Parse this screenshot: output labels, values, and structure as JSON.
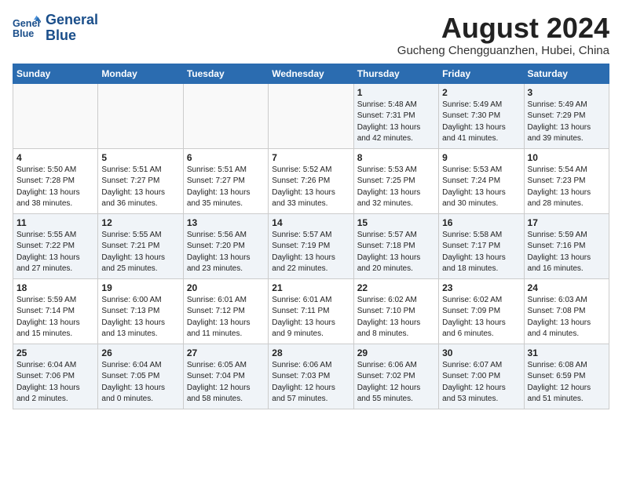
{
  "logo": {
    "line1": "General",
    "line2": "Blue"
  },
  "title": "August 2024",
  "location": "Gucheng Chengguanzhen, Hubei, China",
  "days_of_week": [
    "Sunday",
    "Monday",
    "Tuesday",
    "Wednesday",
    "Thursday",
    "Friday",
    "Saturday"
  ],
  "weeks": [
    [
      {
        "day": "",
        "info": ""
      },
      {
        "day": "",
        "info": ""
      },
      {
        "day": "",
        "info": ""
      },
      {
        "day": "",
        "info": ""
      },
      {
        "day": "1",
        "info": "Sunrise: 5:48 AM\nSunset: 7:31 PM\nDaylight: 13 hours\nand 42 minutes."
      },
      {
        "day": "2",
        "info": "Sunrise: 5:49 AM\nSunset: 7:30 PM\nDaylight: 13 hours\nand 41 minutes."
      },
      {
        "day": "3",
        "info": "Sunrise: 5:49 AM\nSunset: 7:29 PM\nDaylight: 13 hours\nand 39 minutes."
      }
    ],
    [
      {
        "day": "4",
        "info": "Sunrise: 5:50 AM\nSunset: 7:28 PM\nDaylight: 13 hours\nand 38 minutes."
      },
      {
        "day": "5",
        "info": "Sunrise: 5:51 AM\nSunset: 7:27 PM\nDaylight: 13 hours\nand 36 minutes."
      },
      {
        "day": "6",
        "info": "Sunrise: 5:51 AM\nSunset: 7:27 PM\nDaylight: 13 hours\nand 35 minutes."
      },
      {
        "day": "7",
        "info": "Sunrise: 5:52 AM\nSunset: 7:26 PM\nDaylight: 13 hours\nand 33 minutes."
      },
      {
        "day": "8",
        "info": "Sunrise: 5:53 AM\nSunset: 7:25 PM\nDaylight: 13 hours\nand 32 minutes."
      },
      {
        "day": "9",
        "info": "Sunrise: 5:53 AM\nSunset: 7:24 PM\nDaylight: 13 hours\nand 30 minutes."
      },
      {
        "day": "10",
        "info": "Sunrise: 5:54 AM\nSunset: 7:23 PM\nDaylight: 13 hours\nand 28 minutes."
      }
    ],
    [
      {
        "day": "11",
        "info": "Sunrise: 5:55 AM\nSunset: 7:22 PM\nDaylight: 13 hours\nand 27 minutes."
      },
      {
        "day": "12",
        "info": "Sunrise: 5:55 AM\nSunset: 7:21 PM\nDaylight: 13 hours\nand 25 minutes."
      },
      {
        "day": "13",
        "info": "Sunrise: 5:56 AM\nSunset: 7:20 PM\nDaylight: 13 hours\nand 23 minutes."
      },
      {
        "day": "14",
        "info": "Sunrise: 5:57 AM\nSunset: 7:19 PM\nDaylight: 13 hours\nand 22 minutes."
      },
      {
        "day": "15",
        "info": "Sunrise: 5:57 AM\nSunset: 7:18 PM\nDaylight: 13 hours\nand 20 minutes."
      },
      {
        "day": "16",
        "info": "Sunrise: 5:58 AM\nSunset: 7:17 PM\nDaylight: 13 hours\nand 18 minutes."
      },
      {
        "day": "17",
        "info": "Sunrise: 5:59 AM\nSunset: 7:16 PM\nDaylight: 13 hours\nand 16 minutes."
      }
    ],
    [
      {
        "day": "18",
        "info": "Sunrise: 5:59 AM\nSunset: 7:14 PM\nDaylight: 13 hours\nand 15 minutes."
      },
      {
        "day": "19",
        "info": "Sunrise: 6:00 AM\nSunset: 7:13 PM\nDaylight: 13 hours\nand 13 minutes."
      },
      {
        "day": "20",
        "info": "Sunrise: 6:01 AM\nSunset: 7:12 PM\nDaylight: 13 hours\nand 11 minutes."
      },
      {
        "day": "21",
        "info": "Sunrise: 6:01 AM\nSunset: 7:11 PM\nDaylight: 13 hours\nand 9 minutes."
      },
      {
        "day": "22",
        "info": "Sunrise: 6:02 AM\nSunset: 7:10 PM\nDaylight: 13 hours\nand 8 minutes."
      },
      {
        "day": "23",
        "info": "Sunrise: 6:02 AM\nSunset: 7:09 PM\nDaylight: 13 hours\nand 6 minutes."
      },
      {
        "day": "24",
        "info": "Sunrise: 6:03 AM\nSunset: 7:08 PM\nDaylight: 13 hours\nand 4 minutes."
      }
    ],
    [
      {
        "day": "25",
        "info": "Sunrise: 6:04 AM\nSunset: 7:06 PM\nDaylight: 13 hours\nand 2 minutes."
      },
      {
        "day": "26",
        "info": "Sunrise: 6:04 AM\nSunset: 7:05 PM\nDaylight: 13 hours\nand 0 minutes."
      },
      {
        "day": "27",
        "info": "Sunrise: 6:05 AM\nSunset: 7:04 PM\nDaylight: 12 hours\nand 58 minutes."
      },
      {
        "day": "28",
        "info": "Sunrise: 6:06 AM\nSunset: 7:03 PM\nDaylight: 12 hours\nand 57 minutes."
      },
      {
        "day": "29",
        "info": "Sunrise: 6:06 AM\nSunset: 7:02 PM\nDaylight: 12 hours\nand 55 minutes."
      },
      {
        "day": "30",
        "info": "Sunrise: 6:07 AM\nSunset: 7:00 PM\nDaylight: 12 hours\nand 53 minutes."
      },
      {
        "day": "31",
        "info": "Sunrise: 6:08 AM\nSunset: 6:59 PM\nDaylight: 12 hours\nand 51 minutes."
      }
    ]
  ]
}
